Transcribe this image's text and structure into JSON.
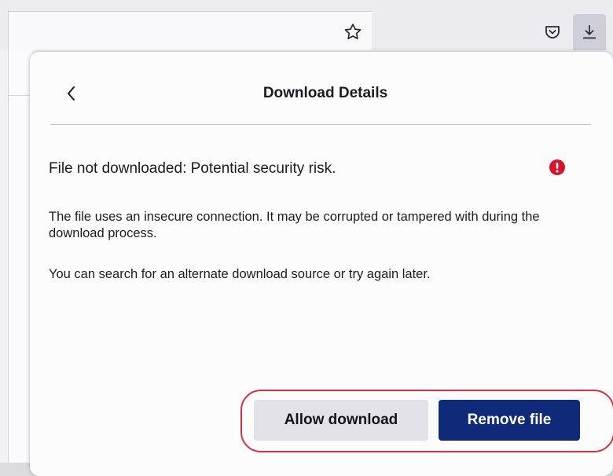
{
  "toolbar": {
    "icons": [
      "star-icon",
      "pocket-icon",
      "download-icon"
    ]
  },
  "panel": {
    "title": "Download Details",
    "back_icon": "chevron-left-icon",
    "status": "File not downloaded: Potential security risk.",
    "status_icon": "error-icon",
    "description_1": "The file uses an insecure connection. It may be corrupted or tampered with during the download process.",
    "description_2": "You can search for an alternate download source or try again later.",
    "allow_label": "Allow download",
    "remove_label": "Remove file"
  },
  "colors": {
    "accent": "#102a7a",
    "error": "#d7142c",
    "highlight": "#d9303f"
  }
}
